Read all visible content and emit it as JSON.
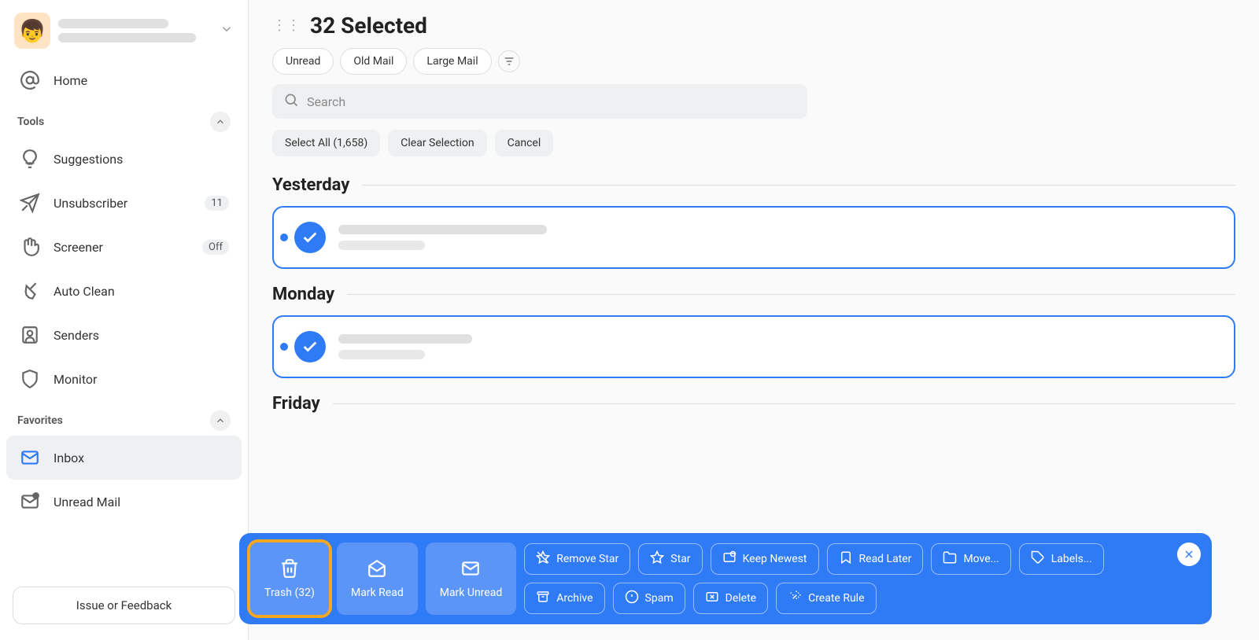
{
  "sidebar": {
    "home_label": "Home",
    "tools_label": "Tools",
    "favorites_label": "Favorites",
    "items": {
      "suggestions": "Suggestions",
      "unsubscriber": "Unsubscriber",
      "unsubscriber_badge": "11",
      "screener": "Screener",
      "screener_badge": "Off",
      "autoclean": "Auto Clean",
      "senders": "Senders",
      "monitor": "Monitor",
      "inbox": "Inbox",
      "unread_mail": "Unread Mail"
    },
    "feedback_label": "Issue or Feedback"
  },
  "main": {
    "title": "32 Selected",
    "filters": {
      "unread": "Unread",
      "old_mail": "Old Mail",
      "large_mail": "Large Mail"
    },
    "search_placeholder": "Search",
    "selection": {
      "select_all": "Select All (1,658)",
      "clear": "Clear Selection",
      "cancel": "Cancel"
    },
    "groups": {
      "yesterday": "Yesterday",
      "monday": "Monday",
      "friday": "Friday"
    }
  },
  "actions": {
    "trash": "Trash (32)",
    "mark_read": "Mark Read",
    "mark_unread": "Mark Unread",
    "remove_star": "Remove Star",
    "star": "Star",
    "keep_newest": "Keep Newest",
    "read_later": "Read Later",
    "move": "Move...",
    "labels": "Labels...",
    "archive": "Archive",
    "spam": "Spam",
    "delete": "Delete",
    "create_rule": "Create Rule"
  }
}
